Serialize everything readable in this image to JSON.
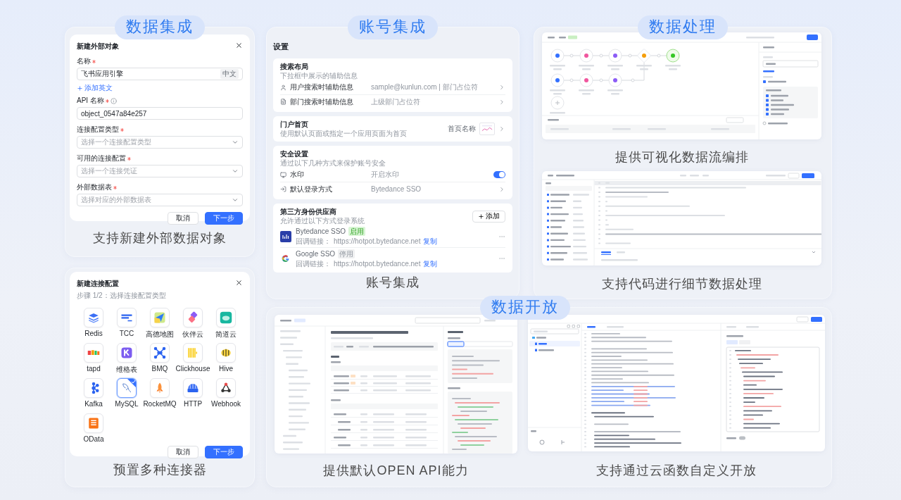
{
  "data_integration": {
    "badge": "数据集成",
    "dialog": {
      "title": "新建外部对象",
      "fields": [
        {
          "label": "名称",
          "required": true,
          "kind": "text",
          "value": "飞书应用引擎",
          "tag": "中文",
          "link": "添加英文"
        },
        {
          "label": "API 名称",
          "required": true,
          "info": true,
          "kind": "text",
          "value": "object_0547a84e257"
        },
        {
          "label": "连接配置类型",
          "required": true,
          "kind": "select",
          "placeholder": "选择一个连接配置类型"
        },
        {
          "label": "可用的连接配置",
          "required": true,
          "kind": "select",
          "placeholder": "选择一个连接凭证"
        },
        {
          "label": "外部数据表",
          "required": true,
          "kind": "select",
          "placeholder": "选择对应的外部数据表"
        }
      ],
      "buttons": [
        {
          "label": "取消",
          "primary": false
        },
        {
          "label": "下一步",
          "primary": true
        }
      ]
    },
    "caption": "支持新建外部数据对象"
  },
  "connectors": {
    "dialog": {
      "title": "新建连接配置",
      "subtitle": "步骤 1/2：选择连接配置类型",
      "items": [
        {
          "label": "Redis",
          "selected": false
        },
        {
          "label": "TCC",
          "selected": false
        },
        {
          "label": "高德地图",
          "selected": false
        },
        {
          "label": "伙伴云",
          "selected": false
        },
        {
          "label": "简道云",
          "selected": false
        },
        {
          "label": "tapd",
          "selected": false
        },
        {
          "label": "维格表",
          "selected": false
        },
        {
          "label": "BMQ",
          "selected": false
        },
        {
          "label": "Clickhouse",
          "selected": false
        },
        {
          "label": "Hive",
          "selected": false
        },
        {
          "label": "Kafka",
          "selected": false
        },
        {
          "label": "MySQL",
          "selected": true
        },
        {
          "label": "RocketMQ",
          "selected": false
        },
        {
          "label": "HTTP",
          "selected": false
        },
        {
          "label": "Webhook",
          "selected": false
        },
        {
          "label": "OData",
          "selected": false
        }
      ],
      "buttons": [
        {
          "label": "取消",
          "primary": false
        },
        {
          "label": "下一步",
          "primary": true
        }
      ]
    },
    "caption": "预置多种连接器"
  },
  "account": {
    "badge": "账号集成",
    "title": "设置",
    "sections": [
      {
        "title": "搜索布局",
        "subtitle": "下拉框中展示的辅助信息",
        "rows": [
          {
            "kind": "link",
            "label": "用户搜索时辅助信息",
            "value": "sample@kunlun.com | 部门占位符"
          },
          {
            "kind": "link",
            "label": "部门搜索时辅助信息",
            "value": "上级部门占位符"
          }
        ]
      },
      {
        "title": "门户首页",
        "subtitle": "使用默认页面或指定一个应用页面为首页",
        "aside": "首页名称"
      },
      {
        "title": "安全设置",
        "subtitle": "通过以下几种方式来保护账号安全",
        "rows": [
          {
            "kind": "toggle",
            "label": "水印",
            "value": "开启水印",
            "on": true
          },
          {
            "kind": "link",
            "label": "默认登录方式",
            "value": "Bytedance SSO"
          }
        ]
      },
      {
        "title": "第三方身份供应商",
        "subtitle": "允许通过以下方式登录系统",
        "action": "添加",
        "providers": [
          {
            "name": "Bytedance SSO",
            "status": "启用",
            "enabled": true,
            "callback_label": "回调链接：",
            "url": "https://hotpot.bytedance.net",
            "copy": "复制"
          },
          {
            "name": "Google SSO",
            "status": "停用",
            "enabled": false,
            "callback_label": "回调链接：",
            "url": "https://hotpot.bytedance.net",
            "copy": "复制"
          }
        ]
      }
    ],
    "caption": "账号集成"
  },
  "processing": {
    "badge": "数据处理",
    "flow_caption": "提供可视化数据流编排",
    "code_caption": "支持代码进行细节数据处理"
  },
  "open": {
    "badge": "数据开放",
    "api_caption": "提供默认OPEN API能力",
    "ide_caption": "支持通过云函数自定义开放"
  }
}
